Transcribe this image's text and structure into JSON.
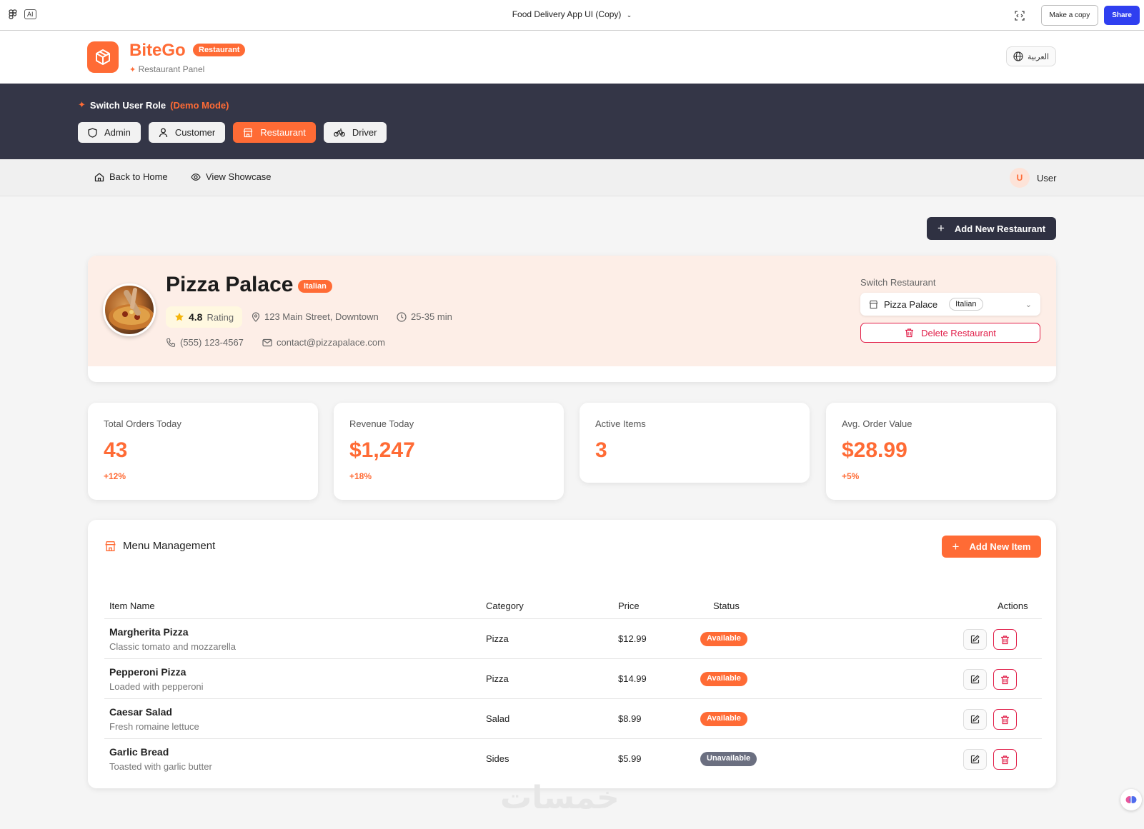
{
  "window": {
    "title": "Food Delivery App UI (Copy)",
    "ai_label": "AI",
    "make_copy_label": "Make a copy",
    "share_label": "Share",
    "share_color": "#2f3ff0"
  },
  "header": {
    "brand": "BiteGo",
    "brand_badge": "Restaurant",
    "subtitle": "Restaurant Panel",
    "language": "العربية",
    "accent": "#ff6b35"
  },
  "role_switch": {
    "title": "Switch User Role",
    "mode": "(Demo Mode)",
    "roles": [
      {
        "label": "Admin",
        "icon": "shield-icon"
      },
      {
        "label": "Customer",
        "icon": "user-icon"
      },
      {
        "label": "Restaurant",
        "icon": "store-icon",
        "active": true
      },
      {
        "label": "Driver",
        "icon": "bike-icon"
      }
    ]
  },
  "nav": {
    "back_home": "Back to Home",
    "view_showcase": "View Showcase",
    "user_initial": "U",
    "user_name": "User"
  },
  "actions": {
    "add_restaurant": "Add New Restaurant"
  },
  "restaurant": {
    "name": "Pizza Palace",
    "cuisine": "Italian",
    "rating": "4.8",
    "rating_label": "Rating",
    "address": "123 Main Street, Downtown",
    "delivery_time": "25-35 min",
    "phone": "(555) 123-4567",
    "email": "contact@pizzapalace.com",
    "switch_label": "Switch Restaurant",
    "selected": "Pizza Palace",
    "selected_badge": "Italian",
    "delete_label": "Delete Restaurant"
  },
  "stats": [
    {
      "label": "Total Orders Today",
      "value": "43",
      "change": "+12%"
    },
    {
      "label": "Revenue Today",
      "value": "$1,247",
      "change": "+18%"
    },
    {
      "label": "Active Items",
      "value": "3",
      "change": ""
    },
    {
      "label": "Avg. Order Value",
      "value": "$28.99",
      "change": "+5%"
    }
  ],
  "menu": {
    "title": "Menu Management",
    "add_item": "Add New Item",
    "columns": [
      "Item Name",
      "Category",
      "Price",
      "Status",
      "Actions"
    ],
    "rows": [
      {
        "name": "Margherita Pizza",
        "desc": "Classic tomato and mozzarella",
        "category": "Pizza",
        "price": "$12.99",
        "status": "Available"
      },
      {
        "name": "Pepperoni Pizza",
        "desc": "Loaded with pepperoni",
        "category": "Pizza",
        "price": "$14.99",
        "status": "Available"
      },
      {
        "name": "Caesar Salad",
        "desc": "Fresh romaine lettuce",
        "category": "Salad",
        "price": "$8.99",
        "status": "Available"
      },
      {
        "name": "Garlic Bread",
        "desc": "Toasted with garlic butter",
        "category": "Sides",
        "price": "$5.99",
        "status": "Unavailable"
      }
    ]
  },
  "watermark": "خمسات"
}
